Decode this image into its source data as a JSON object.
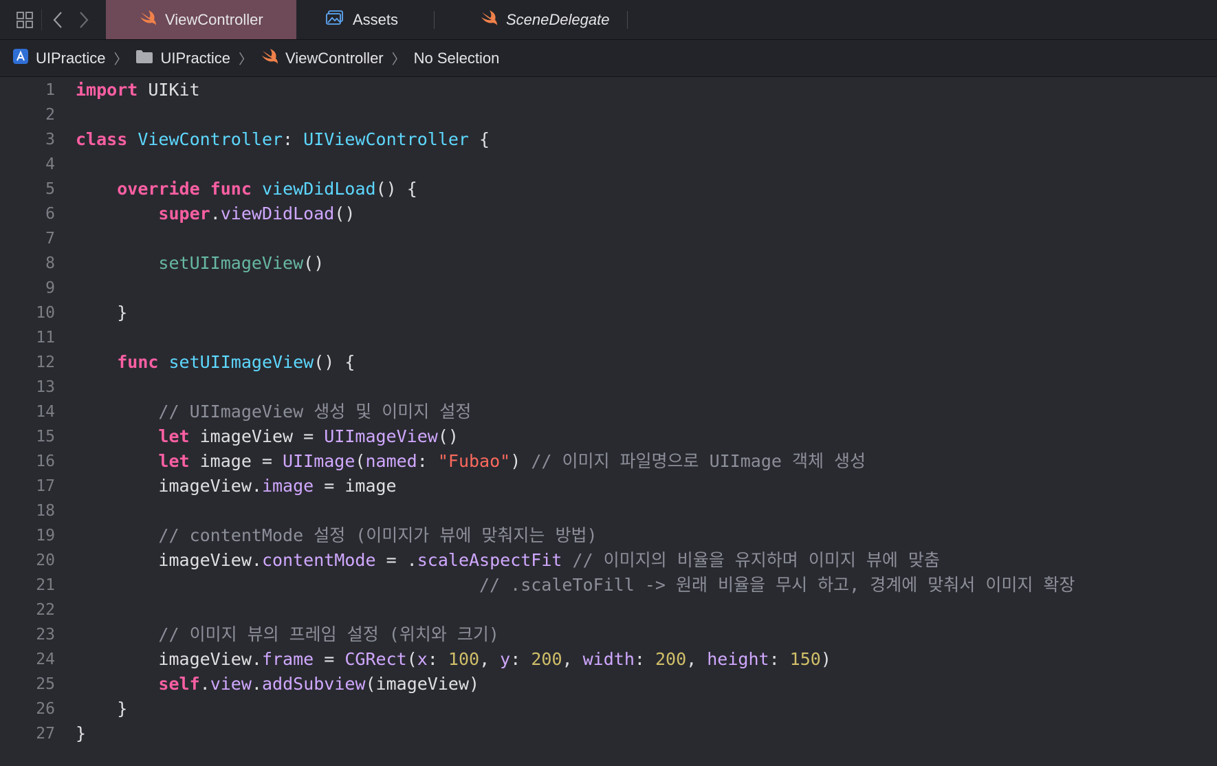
{
  "tabbar": {
    "tabs": [
      {
        "label": "ViewController",
        "icon": "swift-icon",
        "active": true
      },
      {
        "label": "Assets",
        "icon": "assets-icon",
        "active": false
      },
      {
        "label": "SceneDelegate",
        "icon": "swift-icon",
        "active": false
      }
    ]
  },
  "breadcrumb": {
    "items": [
      {
        "label": "UIPractice",
        "icon": "xcode-project-icon"
      },
      {
        "label": "UIPractice",
        "icon": "folder-icon"
      },
      {
        "label": "ViewController",
        "icon": "swift-icon"
      },
      {
        "label": "No Selection",
        "icon": ""
      }
    ]
  },
  "colors": {
    "background": "#292a30",
    "active_tab": "#6e4958",
    "keyword": "#fc5fa3",
    "type": "#5dd8ff",
    "system_member": "#d0a8ff",
    "project_member": "#67b7a4",
    "comment": "#8c8f99",
    "string": "#fc6a5d",
    "number": "#d0bf69"
  },
  "editor": {
    "line_numbers": [
      "1",
      "2",
      "3",
      "4",
      "5",
      "6",
      "7",
      "8",
      "9",
      "10",
      "11",
      "12",
      "13",
      "14",
      "15",
      "16",
      "17",
      "18",
      "19",
      "20",
      "21",
      "22",
      "23",
      "24",
      "25",
      "26",
      "27"
    ],
    "lines": [
      [
        [
          "kw",
          "import"
        ],
        [
          "pl",
          " UIKit"
        ]
      ],
      [],
      [
        [
          "kw",
          "class"
        ],
        [
          "pl",
          " "
        ],
        [
          "ty",
          "ViewController"
        ],
        [
          "pl",
          ": "
        ],
        [
          "ty",
          "UIViewController"
        ],
        [
          "pl",
          " {"
        ]
      ],
      [],
      [
        [
          "pl",
          "    "
        ],
        [
          "kw",
          "override"
        ],
        [
          "pl",
          " "
        ],
        [
          "kw",
          "func"
        ],
        [
          "pl",
          " "
        ],
        [
          "ty",
          "viewDidLoad"
        ],
        [
          "pl",
          "() {"
        ]
      ],
      [
        [
          "pl",
          "        "
        ],
        [
          "kw",
          "super"
        ],
        [
          "pl",
          "."
        ],
        [
          "sys",
          "viewDidLoad"
        ],
        [
          "pl",
          "()"
        ]
      ],
      [],
      [
        [
          "pl",
          "        "
        ],
        [
          "prj",
          "setUIImageView"
        ],
        [
          "pl",
          "()"
        ]
      ],
      [],
      [
        [
          "pl",
          "    }"
        ]
      ],
      [],
      [
        [
          "pl",
          "    "
        ],
        [
          "kw",
          "func"
        ],
        [
          "pl",
          " "
        ],
        [
          "ty",
          "setUIImageView"
        ],
        [
          "pl",
          "() {"
        ]
      ],
      [],
      [
        [
          "pl",
          "        "
        ],
        [
          "cm",
          "// UIImageView 생성 및 이미지 설정"
        ]
      ],
      [
        [
          "pl",
          "        "
        ],
        [
          "kw",
          "let"
        ],
        [
          "pl",
          " imageView = "
        ],
        [
          "sys",
          "UIImageView"
        ],
        [
          "pl",
          "()"
        ]
      ],
      [
        [
          "pl",
          "        "
        ],
        [
          "kw",
          "let"
        ],
        [
          "pl",
          " image = "
        ],
        [
          "sys",
          "UIImage"
        ],
        [
          "pl",
          "("
        ],
        [
          "sys",
          "named"
        ],
        [
          "pl",
          ": "
        ],
        [
          "str",
          "\"Fubao\""
        ],
        [
          "pl",
          ") "
        ],
        [
          "cm",
          "// 이미지 파일명으로 UIImage 객체 생성"
        ]
      ],
      [
        [
          "pl",
          "        imageView."
        ],
        [
          "sys",
          "image"
        ],
        [
          "pl",
          " = image"
        ]
      ],
      [],
      [
        [
          "pl",
          "        "
        ],
        [
          "cm",
          "// contentMode 설정 (이미지가 뷰에 맞춰지는 방법)"
        ]
      ],
      [
        [
          "pl",
          "        imageView."
        ],
        [
          "sys",
          "contentMode"
        ],
        [
          "pl",
          " = ."
        ],
        [
          "sys",
          "scaleAspectFit"
        ],
        [
          "pl",
          " "
        ],
        [
          "cm",
          "// 이미지의 비율을 유지하며 이미지 뷰에 맞춤"
        ]
      ],
      [
        [
          "pl",
          "                                       "
        ],
        [
          "cm",
          "// .scaleToFill -> 원래 비율을 무시 하고, 경계에 맞춰서 이미지 확장"
        ]
      ],
      [],
      [
        [
          "pl",
          "        "
        ],
        [
          "cm",
          "// 이미지 뷰의 프레임 설정 (위치와 크기)"
        ]
      ],
      [
        [
          "pl",
          "        imageView."
        ],
        [
          "sys",
          "frame"
        ],
        [
          "pl",
          " = "
        ],
        [
          "sys",
          "CGRect"
        ],
        [
          "pl",
          "("
        ],
        [
          "sys",
          "x"
        ],
        [
          "pl",
          ": "
        ],
        [
          "num",
          "100"
        ],
        [
          "pl",
          ", "
        ],
        [
          "sys",
          "y"
        ],
        [
          "pl",
          ": "
        ],
        [
          "num",
          "200"
        ],
        [
          "pl",
          ", "
        ],
        [
          "sys",
          "width"
        ],
        [
          "pl",
          ": "
        ],
        [
          "num",
          "200"
        ],
        [
          "pl",
          ", "
        ],
        [
          "sys",
          "height"
        ],
        [
          "pl",
          ": "
        ],
        [
          "num",
          "150"
        ],
        [
          "pl",
          ")"
        ]
      ],
      [
        [
          "pl",
          "        "
        ],
        [
          "kw",
          "self"
        ],
        [
          "pl",
          "."
        ],
        [
          "sys",
          "view"
        ],
        [
          "pl",
          "."
        ],
        [
          "sys",
          "addSubview"
        ],
        [
          "pl",
          "(imageView)"
        ]
      ],
      [
        [
          "pl",
          "    }"
        ]
      ],
      [
        [
          "pl",
          "}"
        ]
      ]
    ]
  }
}
